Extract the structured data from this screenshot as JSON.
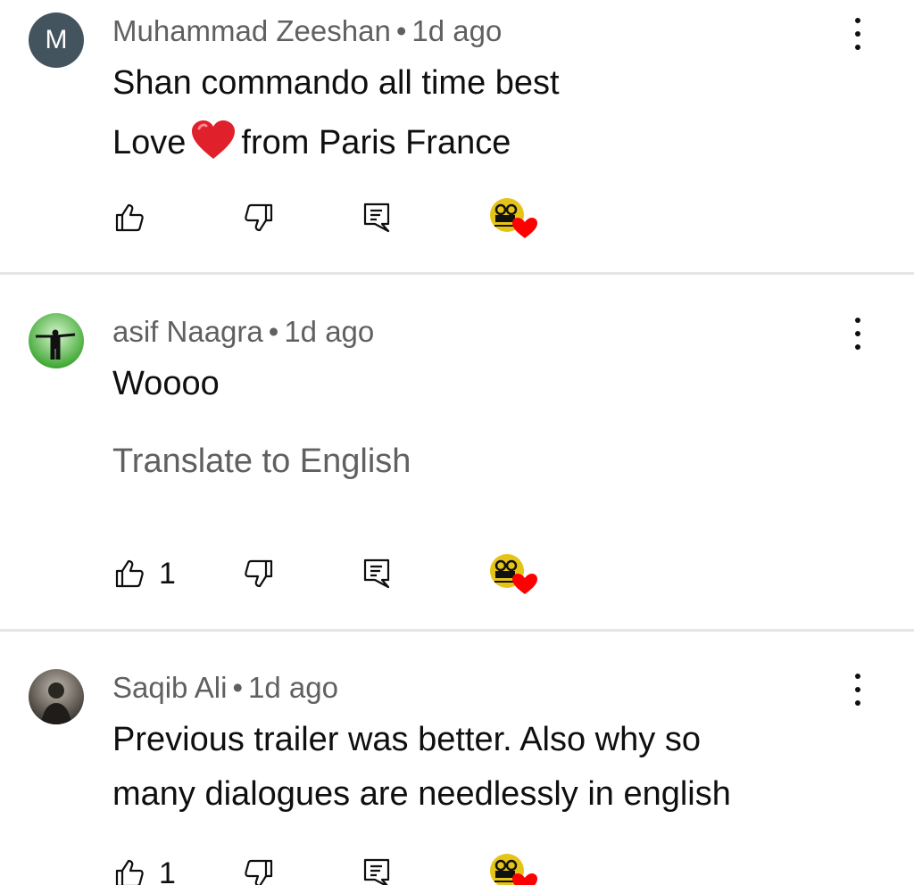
{
  "comments": [
    {
      "avatar_letter": "M",
      "author": "Muhammad Zeeshan",
      "separator": "•",
      "time": "1d ago",
      "lines": [
        "Shan commando all time best",
        "Love",
        "from Paris France"
      ],
      "like_count": "",
      "more_icon": "three-dot-vertical-icon"
    },
    {
      "author": "asif Naagra",
      "separator": "•",
      "time": "1d ago",
      "lines": [
        "Woooo"
      ],
      "translate_label": "Translate to English",
      "like_count": "1",
      "more_icon": "three-dot-vertical-icon"
    },
    {
      "author": "Saqib Ali",
      "separator": "•",
      "time": "1d ago",
      "lines": [
        "Previous trailer was better. Also why so",
        "many dialogues are needlessly  in english"
      ],
      "like_count": "1",
      "more_icon": "three-dot-vertical-icon"
    }
  ],
  "icons": {
    "like": "thumbs-up-icon",
    "dislike": "thumbs-down-icon",
    "reply": "reply-icon",
    "creator_heart": "creator-heart-icon",
    "heart_emoji": "red-heart-emoji"
  },
  "colors": {
    "text_primary": "#0f0f0f",
    "text_secondary": "#606060",
    "divider": "#e5e5e5",
    "avatar_m": "#44545f",
    "heart": "#ff0000"
  }
}
